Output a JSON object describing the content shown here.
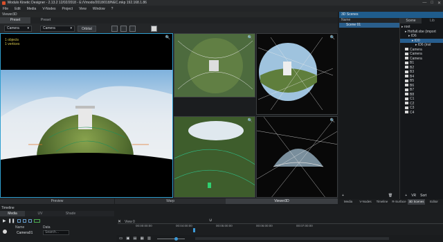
{
  "window": {
    "title": "Modulo Kinetic Designer - 2.13.2 12/02/2018 - E:/Vmodo/2018/018/NEC.mkp   192.168.1.86",
    "controls": [
      "—",
      "□",
      "✕"
    ]
  },
  "menu": [
    "File",
    "Edit",
    "Media",
    "V-Nodes",
    "Project",
    "View",
    "Window",
    "?"
  ],
  "viewer": {
    "label": "Viewer3D",
    "tabs": [
      "Preset",
      "Preset"
    ],
    "camera_dropdown_1": "Camera",
    "camera_dropdown_2": "Camera",
    "orbital_button": "Orbital",
    "main_info": [
      "1 objects",
      "1 vertices"
    ]
  },
  "bottom_tabs": [
    "Preview",
    "Warp",
    "Viewer3D"
  ],
  "right_panel": {
    "header": "3D Scenes",
    "col_name": "Name",
    "scene_item": "Scene 01",
    "tabs": [
      "Scene",
      "Lib"
    ],
    "tree": [
      {
        "label": "root",
        "type": "node",
        "indent": 0
      },
      {
        "label": "Hotfall.obe (import",
        "type": "node",
        "indent": 1
      },
      {
        "label": "ID6",
        "type": "node",
        "indent": 2
      },
      {
        "label": "ID0",
        "type": "node",
        "indent": 3,
        "selected": true
      },
      {
        "label": "ID6 (inst",
        "type": "node",
        "indent": 4
      },
      {
        "label": "Camera",
        "type": "folder",
        "indent": 1
      },
      {
        "label": "Camera",
        "type": "folder",
        "indent": 1
      },
      {
        "label": "Camera",
        "type": "folder",
        "indent": 1
      },
      {
        "label": "B1",
        "type": "folder",
        "indent": 1
      },
      {
        "label": "B2",
        "type": "folder",
        "indent": 1
      },
      {
        "label": "B3",
        "type": "folder",
        "indent": 1
      },
      {
        "label": "B4",
        "type": "folder",
        "indent": 1
      },
      {
        "label": "B5",
        "type": "folder",
        "indent": 1
      },
      {
        "label": "B6",
        "type": "folder",
        "indent": 1
      },
      {
        "label": "B7",
        "type": "folder",
        "indent": 1
      },
      {
        "label": "B8",
        "type": "folder",
        "indent": 1
      },
      {
        "label": "C1",
        "type": "folder",
        "indent": 1
      },
      {
        "label": "C2",
        "type": "folder",
        "indent": 1
      },
      {
        "label": "C3",
        "type": "folder",
        "indent": 1
      },
      {
        "label": "C4",
        "type": "folder",
        "indent": 1
      }
    ],
    "actions": [
      "VR",
      "Sort"
    ],
    "bottom_tabs": [
      "Media",
      "V-Nodes",
      "Timeline",
      "R-Surface",
      "3D Scenes",
      "Editor"
    ]
  },
  "timeline": {
    "label": "Timeline",
    "tabs": [
      "Media",
      "UV",
      "Shade"
    ],
    "col_name": "Name",
    "col_data": "Data",
    "layer_name": "Camera01",
    "search_placeholder": "Search...",
    "view_label": "View",
    "view_value": "0",
    "ruler": [
      "00:00:00:00",
      "00:04:00:00",
      "00:05:00:00",
      "00:06:00:00",
      "00:07:00:00"
    ]
  }
}
